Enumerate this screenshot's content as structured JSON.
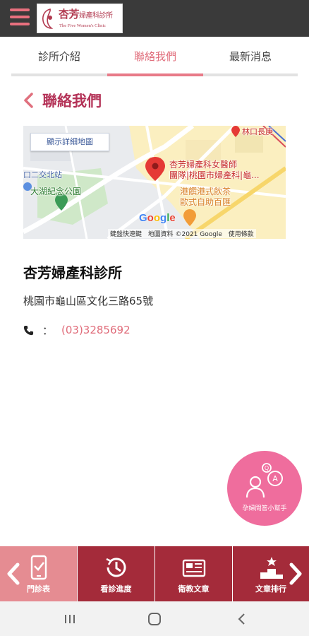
{
  "header": {
    "logo_title": "杏芳",
    "logo_title_small": "婦產科診所",
    "logo_subtitle": "The Five Women's Clinic",
    "menu_icon": "hamburger-icon",
    "accent_color": "#e8707e"
  },
  "tabs": [
    {
      "label": "診所介紹",
      "active": false
    },
    {
      "label": "聯絡我們",
      "active": true
    },
    {
      "label": "最新消息",
      "active": false
    }
  ],
  "page": {
    "title": "聯絡我們",
    "title_color": "#b43358"
  },
  "map": {
    "show_map_button": "顯示詳細地圖",
    "place_name_line1": "杏芳婦產科女醫師",
    "place_name_line2": "團隊|桃園市婦產科|龜...",
    "poi_station": "口二交北站",
    "poi_park": "大湖紀念公園",
    "poi_restaurant_line1": "港饌港式飲茶",
    "poi_restaurant_line2": "歐式自助百匯",
    "poi_top": "林口長庚",
    "google": "Google",
    "footer_shortcuts": "鍵盤快速鍵",
    "footer_data": "地圖資料 ©2021 Google",
    "footer_terms": "使用條款"
  },
  "clinic": {
    "name": "杏芳婦產科診所",
    "address": "桃園市龜山區文化三路65號",
    "phone_separator": "：",
    "phone": "(03)3285692"
  },
  "fab": {
    "label": "孕婦問答小幫手",
    "color": "#ef6d9d"
  },
  "bottom_menu": [
    {
      "label": "門診表",
      "icon": "phone-schedule-icon"
    },
    {
      "label": "看診進度",
      "icon": "clock-progress-icon"
    },
    {
      "label": "衛教文章",
      "icon": "newspaper-icon"
    },
    {
      "label": "文章排行",
      "icon": "podium-ranking-icon"
    }
  ]
}
